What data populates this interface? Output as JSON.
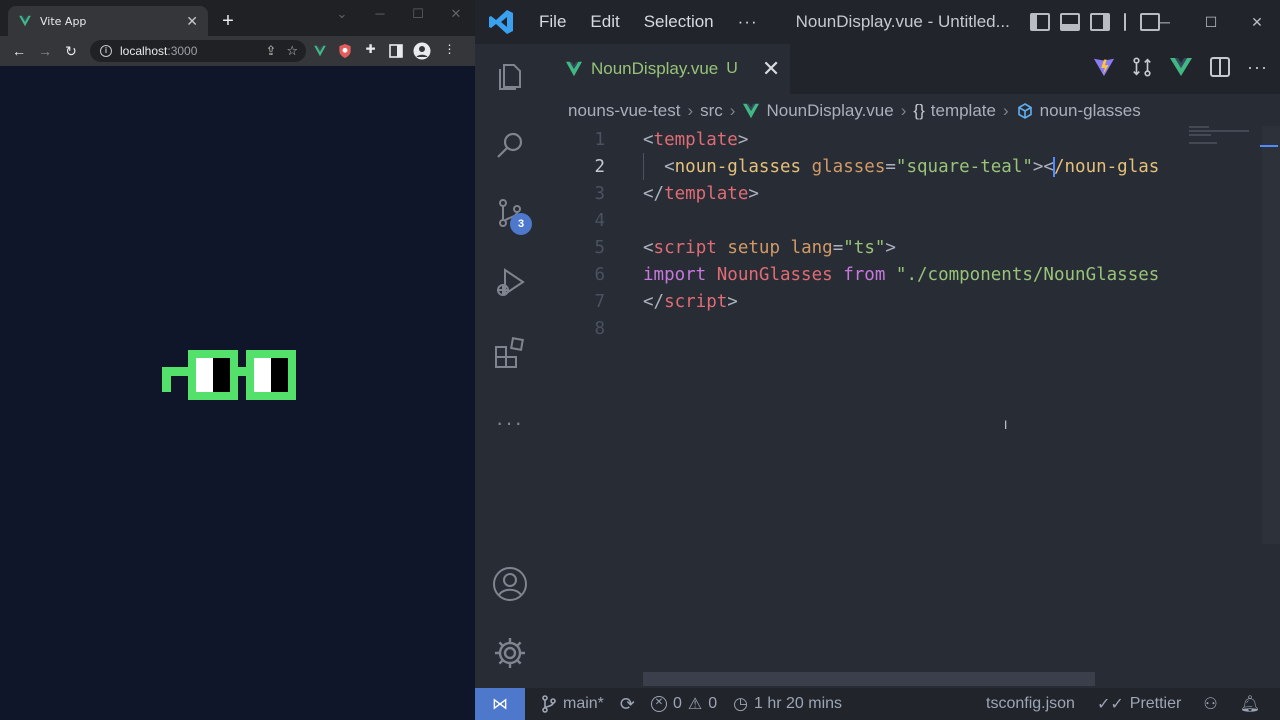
{
  "browser": {
    "tab_title": "Vite App",
    "new_tab": "+",
    "url_host": "localhost",
    "url_port": ":3000",
    "glasses_color": "#53e06b"
  },
  "vscode": {
    "menu": [
      "File",
      "Edit",
      "Selection",
      "···"
    ],
    "window_title": "NounDisplay.vue - Untitled...",
    "tab": {
      "name": "NounDisplay.vue",
      "status": "U"
    },
    "breadcrumb": [
      "nouns-vue-test",
      "src",
      "NounDisplay.vue",
      "template",
      "noun-glasses"
    ],
    "scm_badge": "3",
    "line_numbers": [
      "1",
      "2",
      "3",
      "4",
      "5",
      "6",
      "7",
      "8"
    ],
    "code": {
      "l1_lt": "<",
      "l1_tag": "template",
      "l1_gt": ">",
      "l2_indent": "  ",
      "l2_lt": "<",
      "l2_tag": "noun-glasses",
      "l2_sp": " ",
      "l2_attr": "glasses",
      "l2_eq": "=",
      "l2_val": "\"square-teal\"",
      "l2_gt": "><",
      "l2_close": "/noun-glas",
      "l3_lt": "</",
      "l3_tag": "template",
      "l3_gt": ">",
      "l5_lt": "<",
      "l5_tag": "script",
      "l5_sp1": " ",
      "l5_attr1": "setup",
      "l5_sp2": " ",
      "l5_attr2": "lang",
      "l5_eq": "=",
      "l5_val": "\"ts\"",
      "l5_gt": ">",
      "l6_import": "import",
      "l6_sp1": " ",
      "l6_name": "NounGlasses",
      "l6_sp2": " ",
      "l6_from": "from",
      "l6_sp3": " ",
      "l6_path": "\"./components/NounGlasses",
      "l7_lt": "</",
      "l7_tag": "script",
      "l7_gt": ">"
    },
    "status": {
      "branch": "main*",
      "errors": "0",
      "warnings": "0",
      "time": "1 hr 20 mins",
      "config": "tsconfig.json",
      "formatter": "Prettier"
    }
  },
  "colors": {
    "vue_green": "#41b883",
    "accent_blue": "#4d78cc",
    "tag_red": "#e06c75",
    "string_green": "#98c379",
    "keyword_purple": "#c678dd"
  }
}
